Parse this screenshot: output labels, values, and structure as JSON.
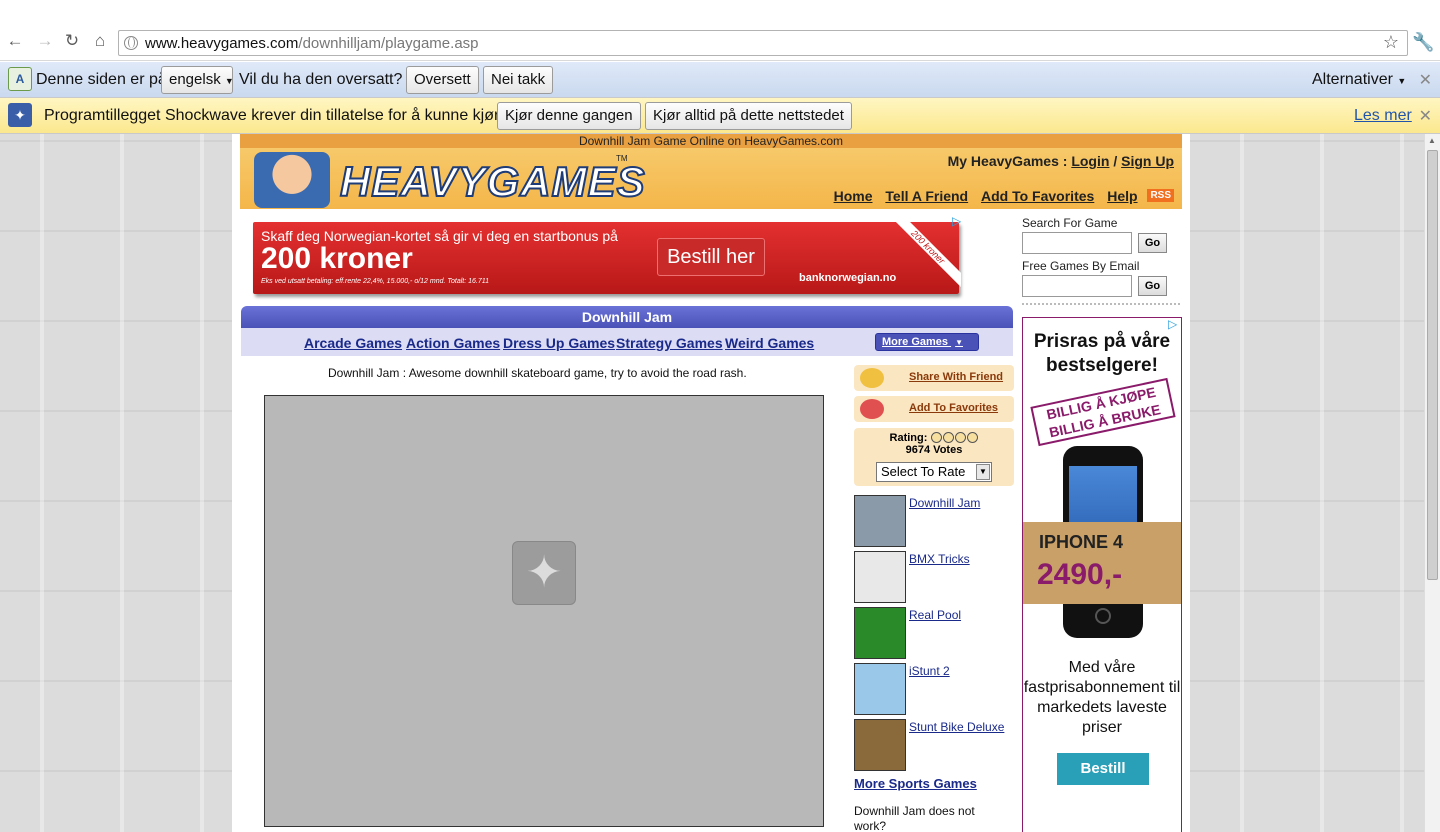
{
  "browser": {
    "url_host": "www.heavygames.com",
    "url_path": "/downhilljam/playgame.asp",
    "icons": [
      "back-icon",
      "forward-icon",
      "reload-icon",
      "home-icon",
      "globe-icon",
      "star-icon",
      "wrench-icon"
    ]
  },
  "translate_bar": {
    "text_prefix": "Denne siden er på",
    "language": "engelsk",
    "question": "Vil du ha den oversatt?",
    "translate_button": "Oversett",
    "decline_button": "Nei takk",
    "options": "Alternativer",
    "close": "✕"
  },
  "plugin_bar": {
    "message": "Programtillegget Shockwave krever din tillatelse for å kunne kjøre.",
    "run_once_button": "Kjør denne gangen",
    "run_always_button": "Kjør alltid på dette nettstedet",
    "learn_more": "Les mer",
    "close": "✕"
  },
  "site": {
    "header_top": "Downhill Jam Game Online on HeavyGames.com",
    "logo_text": "HEAVYGAMES",
    "trademark": "TM",
    "my_heavygames": "My HeavyGames :",
    "login": "Login",
    "separator": "/",
    "signup": "Sign Up",
    "nav": [
      "Home",
      "Tell A Friend",
      "Add To Favorites",
      "Help"
    ],
    "rss": "RSS"
  },
  "banner_ad": {
    "line1": "Skaff deg Norwegian-kortet så gir vi deg en startbonus på",
    "line2": "200 kroner",
    "small_print": "Eks ved utsatt betaling: eff.rente 22,4%, 15.000,- o/12 mnd. Totalt: 16.711",
    "button": "Bestill her",
    "brand": "banknorwegian.no",
    "ribbon": "200 kroner"
  },
  "search": {
    "label": "Search For Game",
    "go": "Go",
    "email_label": "Free Games By Email",
    "email_go": "Go"
  },
  "game": {
    "title": "Downhill Jam",
    "categories": [
      "Arcade Games",
      "Action Games",
      "Dress Up Games",
      "Strategy Games",
      "Weird Games"
    ],
    "more_games": "More Games",
    "description": "Downhill Jam : Awesome downhill skateboard game, try to avoid the road rash."
  },
  "sidebar": {
    "share": "Share With Friend",
    "favorites": "Add To Favorites",
    "rating_label": "Rating:",
    "votes": "9674 Votes",
    "rate_select": "Select To Rate",
    "related": [
      {
        "name": "Downhill Jam",
        "color": "#8a9aa8"
      },
      {
        "name": "BMX Tricks",
        "color": "#e8e8e8"
      },
      {
        "name": "Real Pool",
        "color": "#2a8a2a"
      },
      {
        "name": "iStunt 2",
        "color": "#9ac8e8"
      },
      {
        "name": "Stunt Bike Deluxe",
        "color": "#8a6a3a"
      }
    ],
    "more_sports": "More Sports Games",
    "not_work": "Downhill Jam does not work?"
  },
  "right_ad": {
    "headline": "Prisras på våre bestselgere!",
    "tag_line1": "BILLIG Å KJØPE",
    "tag_line2": "BILLIG Å BRUKE",
    "product": "IPHONE 4",
    "price": "2490,-",
    "body": "Med våre fastprisabonnement til markedets laveste priser",
    "button": "Bestill"
  },
  "colors": {
    "header_orange": "#f4b64a",
    "title_blue": "#4a52b8",
    "link_blue": "#1a2a8a",
    "ad_purple": "#8a1a6a"
  }
}
